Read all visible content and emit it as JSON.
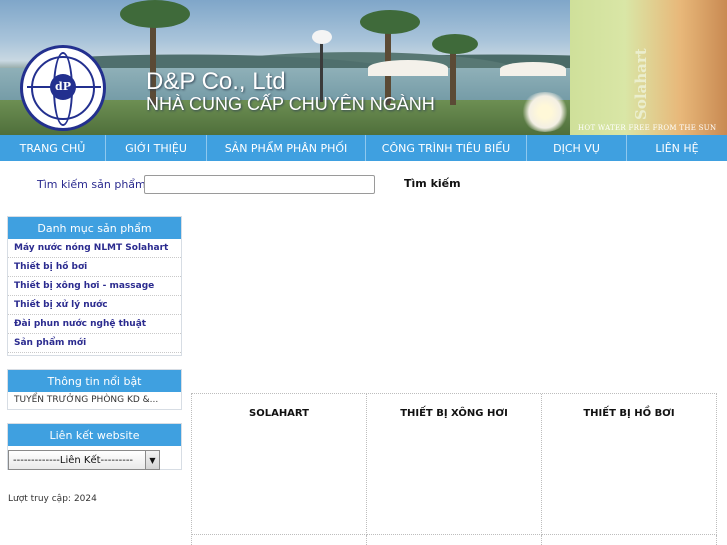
{
  "header": {
    "company": "D&P Co., Ltd",
    "tagline": "NHÀ CUNG CẤP CHUYÊN NGÀNH",
    "logo_text": "dP",
    "side_brand": "Solahart",
    "side_caption": "HOT WATER FREE FROM THE SUN"
  },
  "nav": {
    "items": [
      {
        "label": "TRANG CHỦ"
      },
      {
        "label": "GIỚI THIỆU"
      },
      {
        "label": "SẢN PHẨM PHÂN PHỐI"
      },
      {
        "label": "CÔNG TRÌNH TIÊU BIỂU"
      },
      {
        "label": "DỊCH VỤ"
      },
      {
        "label": "LIÊN HỆ"
      }
    ]
  },
  "search": {
    "label": "Tìm kiếm sản phẩm",
    "value": "",
    "button": "Tìm kiếm"
  },
  "sidebar": {
    "categories": {
      "title": "Danh mục sản phẩm",
      "items": [
        {
          "label": "Máy nước nóng NLMT Solahart"
        },
        {
          "label": "Thiết bị hồ bơi"
        },
        {
          "label": "Thiết bị xông hơi - massage"
        },
        {
          "label": "Thiết bị xử lý nước"
        },
        {
          "label": "Đài phun nước nghệ thuật"
        },
        {
          "label": "Sản phẩm mới"
        }
      ]
    },
    "news": {
      "title": "Thông tin nổi bật",
      "items": [
        {
          "label": "TUYỂN TRƯỞNG PHÒNG KD &..."
        }
      ]
    },
    "links": {
      "title": "Liên kết website",
      "selected": "-------------Liên Kết---------"
    }
  },
  "visits": {
    "label": "Lượt truy cập:",
    "count": "2024"
  },
  "products": [
    {
      "title": "SOLAHART"
    },
    {
      "title": "THIẾT BỊ XÔNG HƠI"
    },
    {
      "title": "THIẾT BỊ HỒ BƠI"
    }
  ],
  "colors": {
    "nav_bg": "#3fa0e0",
    "link_text": "#2b2b8f",
    "logo_blue": "#23308f"
  }
}
